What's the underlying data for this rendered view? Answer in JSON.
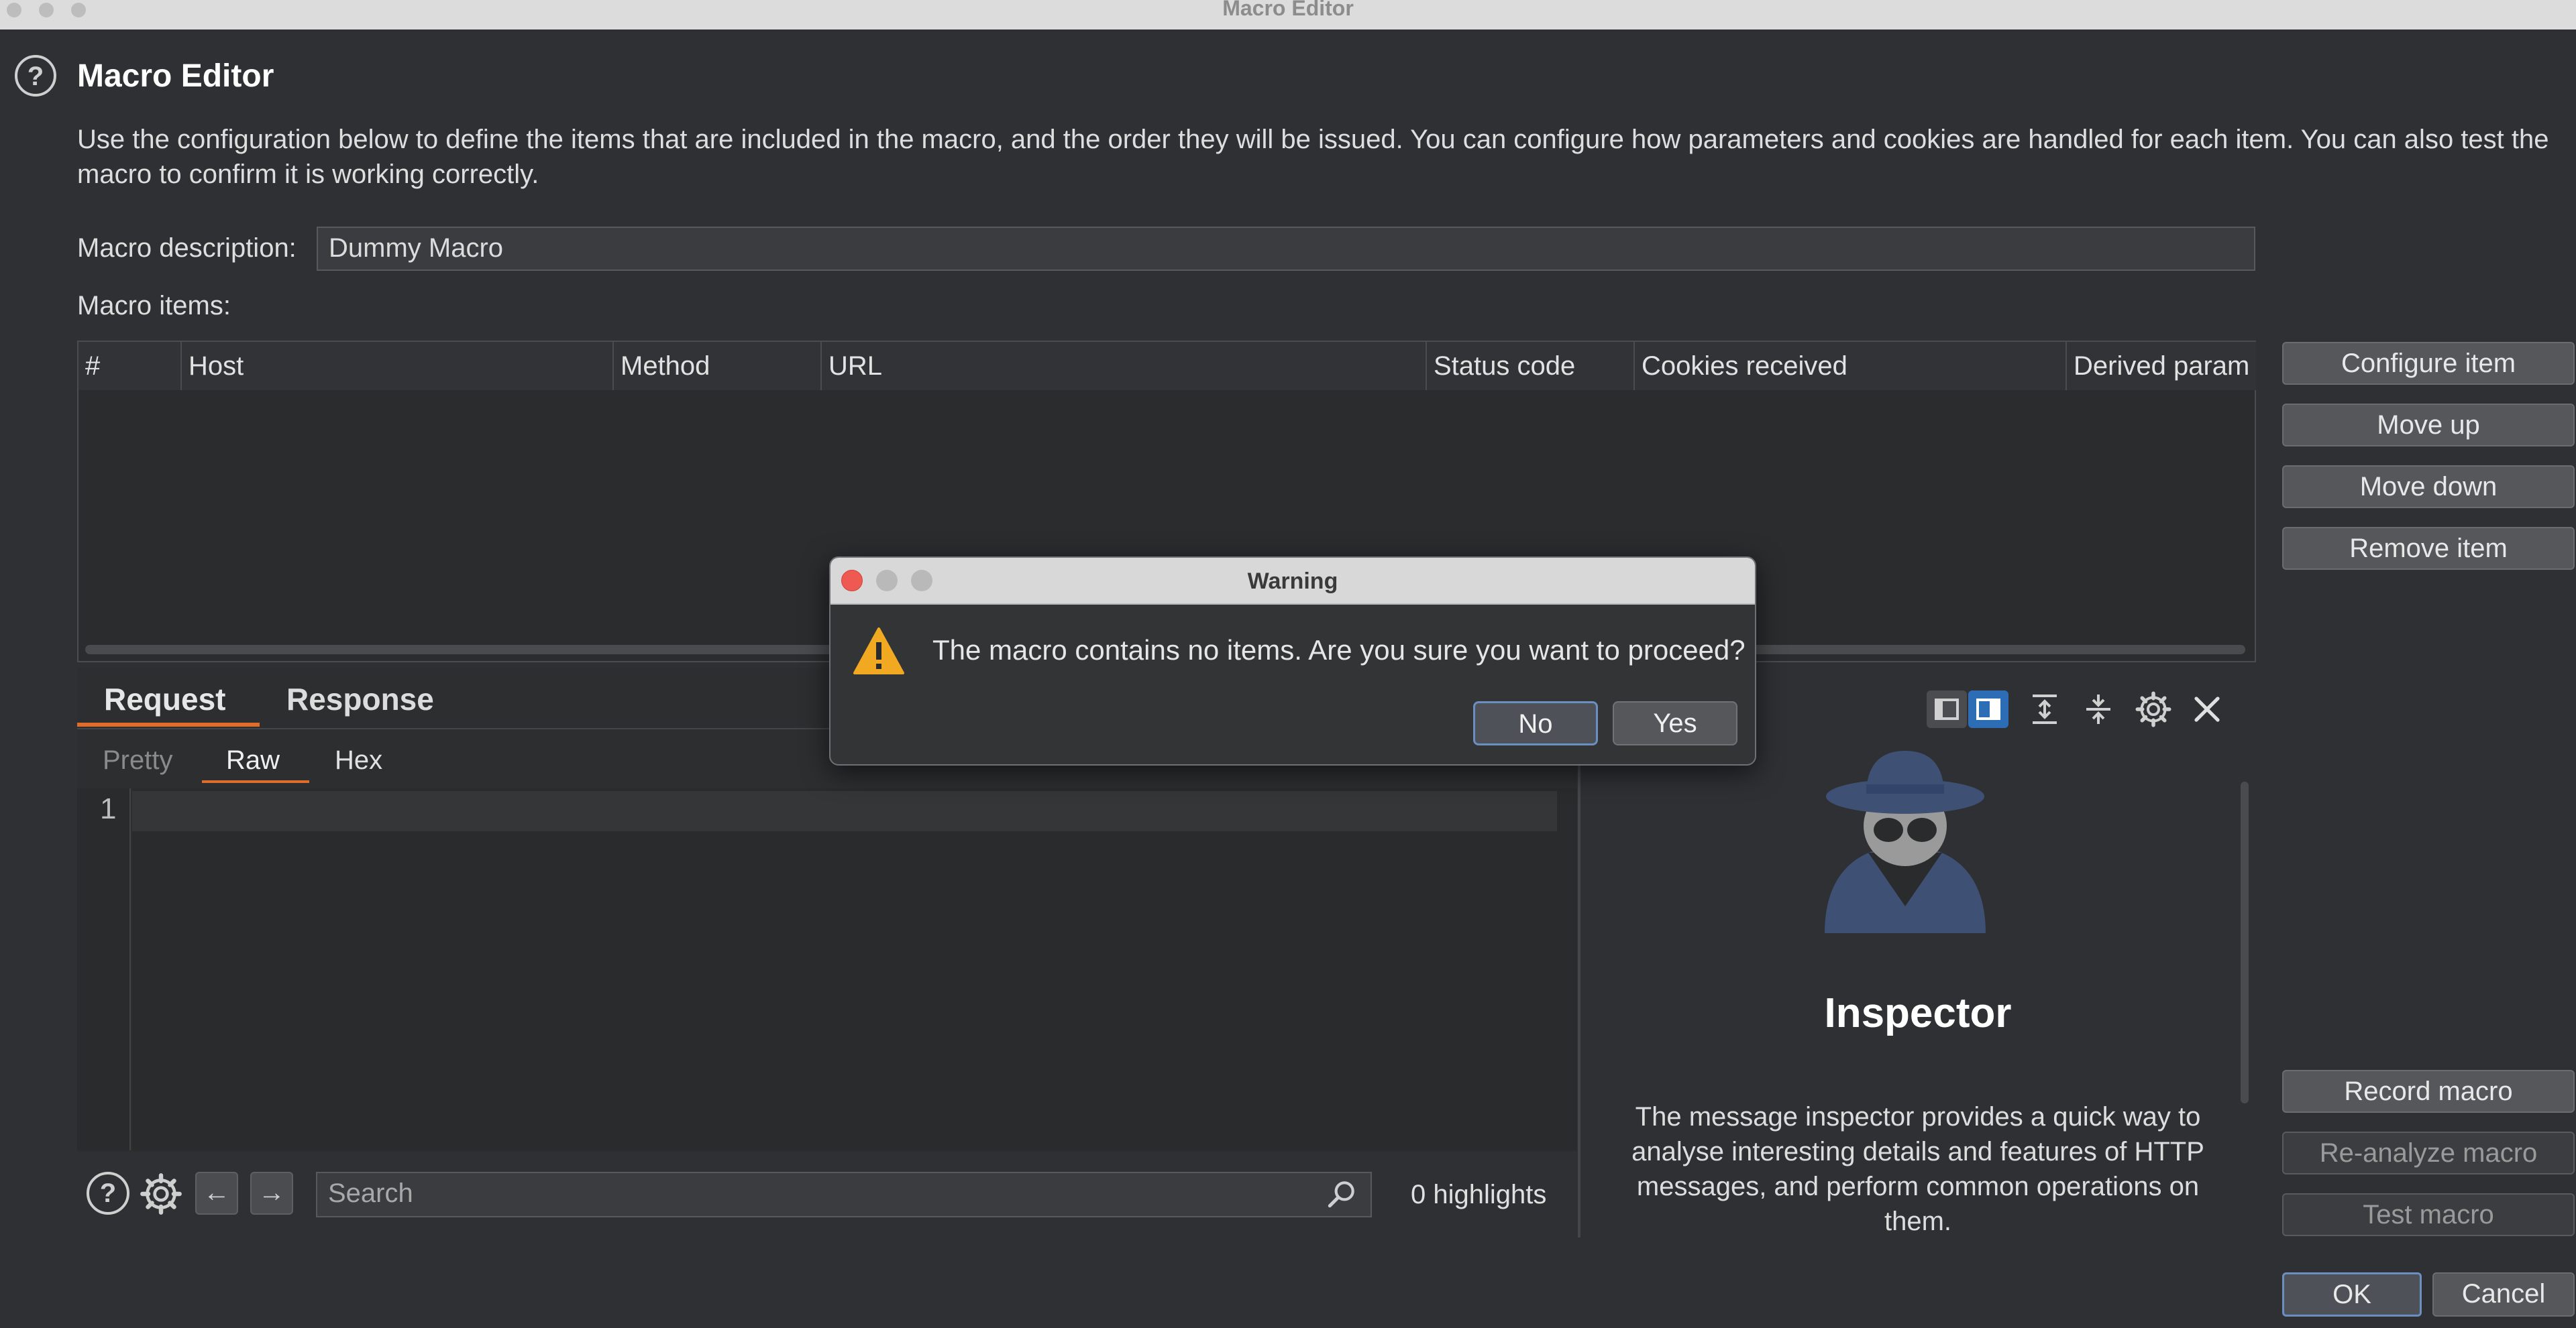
{
  "window": {
    "title": "Macro Editor"
  },
  "header": {
    "title": "Macro Editor",
    "description": "Use the configuration below to define the items that are included in the macro, and the order they will be issued. You can configure how parameters and cookies are handled for each item. You can also test the macro to confirm it is working correctly."
  },
  "form": {
    "description_label": "Macro description:",
    "description_value": "Dummy Macro",
    "items_label": "Macro items:"
  },
  "table": {
    "columns": [
      "#",
      "Host",
      "Method",
      "URL",
      "Status code",
      "Cookies received",
      "Derived param"
    ]
  },
  "side_buttons": {
    "configure": "Configure item",
    "move_up": "Move up",
    "move_down": "Move down",
    "remove": "Remove item",
    "record": "Record macro",
    "reanalyze": "Re-analyze macro",
    "test": "Test macro"
  },
  "message_tabs": {
    "request": "Request",
    "response": "Response"
  },
  "view_tabs": {
    "pretty": "Pretty",
    "raw": "Raw",
    "hex": "Hex"
  },
  "editor": {
    "line_number": "1"
  },
  "search": {
    "placeholder": "Search",
    "highlights": "0 highlights"
  },
  "inspector": {
    "title": "Inspector",
    "text": "The message inspector provides a quick way to analyse interesting details and features of HTTP messages, and perform common operations on them."
  },
  "footer": {
    "ok": "OK",
    "cancel": "Cancel"
  },
  "dialog": {
    "title": "Warning",
    "message": "The macro contains no items. Are you sure you want to proceed?",
    "no": "No",
    "yes": "Yes"
  },
  "colors": {
    "accent": "#e06c2c",
    "selected_view": "#2d6db5",
    "warning": "#f2a922"
  }
}
